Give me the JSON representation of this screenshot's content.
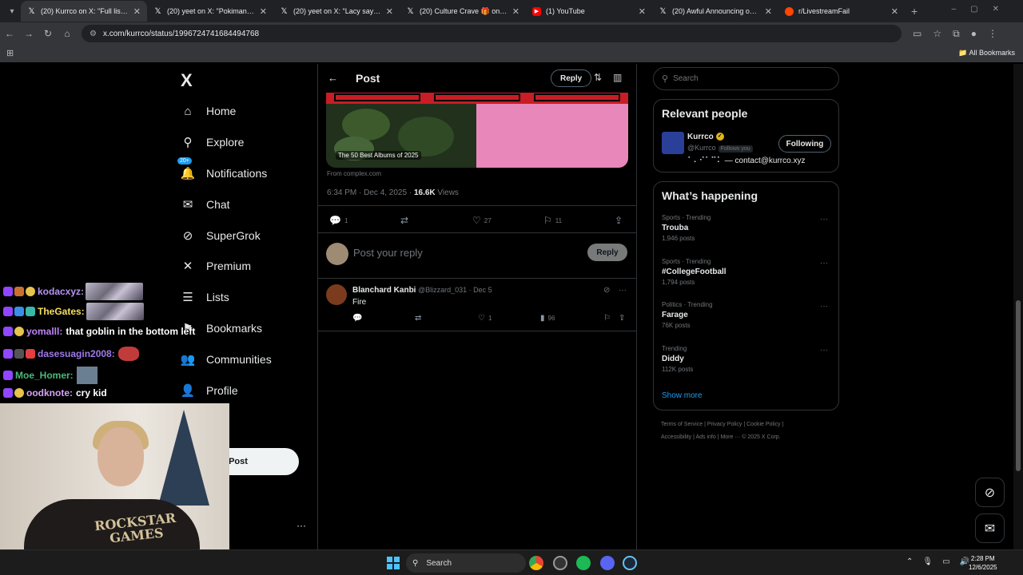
{
  "browser": {
    "tabs": [
      {
        "title": "(20) Kurrco on X: \"Full list: http",
        "active": true,
        "icon": "x-icon"
      },
      {
        "title": "(20) yeet on X: \"Pokimane accid",
        "active": false,
        "icon": "x-icon"
      },
      {
        "title": "(20) yeet on X: \"Lacy says that t",
        "active": false,
        "icon": "x-icon"
      },
      {
        "title": "(20) Culture Crave 🎁 on X: \"Ne",
        "active": false,
        "icon": "x-icon"
      },
      {
        "title": "(1) YouTube",
        "active": false,
        "icon": "youtube-icon"
      },
      {
        "title": "(20) Awful Announcing on X: \"I",
        "active": false,
        "icon": "x-icon"
      },
      {
        "title": "r/LivestreamFail",
        "active": false,
        "icon": "reddit-icon"
      }
    ],
    "url": "x.com/kurrco/status/1996724741684494768",
    "all_bookmarks": "All Bookmarks"
  },
  "sidebar": {
    "logo": "X",
    "items": [
      {
        "label": "Home",
        "icon": "home-icon"
      },
      {
        "label": "Explore",
        "icon": "search-icon"
      },
      {
        "label": "Notifications",
        "icon": "bell-icon",
        "badge": "20+"
      },
      {
        "label": "Chat",
        "icon": "mail-icon"
      },
      {
        "label": "SuperGrok",
        "icon": "grok-icon"
      },
      {
        "label": "Premium",
        "icon": "x-icon"
      },
      {
        "label": "Lists",
        "icon": "list-icon"
      },
      {
        "label": "Bookmarks",
        "icon": "bookmark-icon"
      },
      {
        "label": "Communities",
        "icon": "people-icon"
      },
      {
        "label": "Profile",
        "icon": "person-icon"
      }
    ],
    "post_button": "Post",
    "more": "···"
  },
  "main": {
    "header_title": "Post",
    "header_reply": "Reply",
    "card_title": "The 50 Best Albums of 2025",
    "card_source": "From complex.com",
    "timestamp": "6:34 PM · Dec 4, 2025 · ",
    "views_count": "16.6K",
    "views_label": " Views",
    "actions": {
      "replies": "1",
      "retweets": "",
      "likes": "27",
      "bookmarks": "11"
    },
    "reply_placeholder": "Post your reply",
    "reply_button": "Reply",
    "reply_tweet": {
      "name": "Blanchard Kanbi",
      "handle": "@Blizzard_031 · Dec 5",
      "text": "Fire",
      "likes": "1",
      "views": "96"
    }
  },
  "right": {
    "search_placeholder": "Search",
    "relevant_title": "Relevant people",
    "person": {
      "name": "Kurrco",
      "handle": "@Kurrco",
      "follows_you": "Follows you",
      "button": "Following",
      "bio": "⠁⠄⠊⠁⠉⠅ — contact@kurrco.xyz"
    },
    "happening_title": "What’s happening",
    "trends": [
      {
        "category": "Sports · Trending",
        "name": "Trouba",
        "count": "1,946 posts"
      },
      {
        "category": "Sports · Trending",
        "name": "#CollegeFootball",
        "count": "1,794 posts"
      },
      {
        "category": "Politics · Trending",
        "name": "Farage",
        "count": "76K posts"
      },
      {
        "category": "Trending",
        "name": "Diddy",
        "count": "112K posts"
      }
    ],
    "show_more": "Show more",
    "footer_line1": "Terms of Service  |  Privacy Policy  |  Cookie Policy  |",
    "footer_line2": "Accessibility  |  Ads info  |  More ···  © 2025 X Corp."
  },
  "chat": [
    {
      "user": "kodacxyz:",
      "color": "#b794f4",
      "message": "",
      "emote": true
    },
    {
      "user": "TheGates:",
      "color": "#f6e05e",
      "message": "",
      "emote": true
    },
    {
      "user": "yomalll:",
      "color": "#c084fc",
      "message": "that goblin in the bottom left",
      "emote": false
    },
    {
      "user": "dasesuagin2008:",
      "color": "#9f7aea",
      "message": "",
      "emote": false
    },
    {
      "user": "Moe_Homer:",
      "color": "#48bb78",
      "message": "",
      "emote": false
    },
    {
      "user": "oodknote:",
      "color": "#d6a2f5",
      "message": "cry kid",
      "emote": false
    }
  ],
  "webcam": {
    "shirt_text": "ROCKSTAR GAMES"
  },
  "taskbar": {
    "search": "Search",
    "time": "2:28 PM",
    "date": "12/6/2025"
  }
}
